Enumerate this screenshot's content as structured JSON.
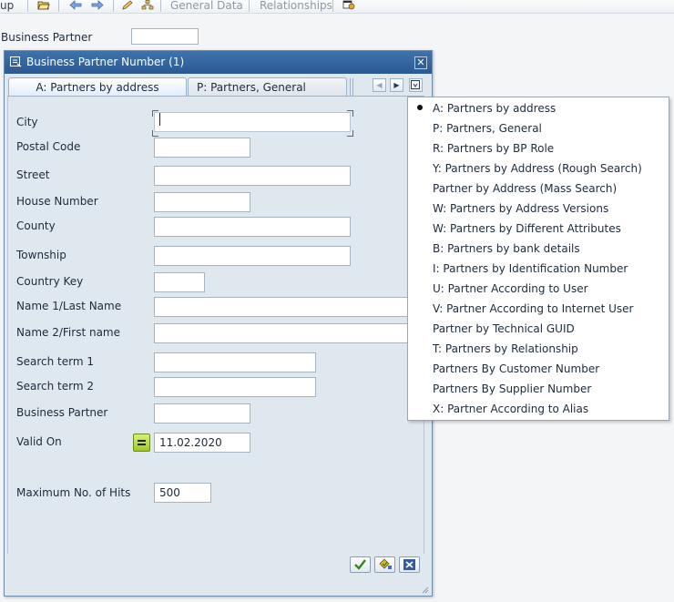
{
  "toolbar": {
    "group_tail_label": "up",
    "general_data_label": "General Data",
    "relationships_label": "Relationships"
  },
  "background": {
    "business_partner_label": "Business Partner"
  },
  "dialog": {
    "title": "Business Partner Number (1)",
    "close_glyph": "✕",
    "tabs": {
      "active": "A: Partners by address",
      "inactive": "P: Partners, General"
    },
    "fields": {
      "city": {
        "label": "City",
        "value": ""
      },
      "postal_code": {
        "label": "Postal Code",
        "value": ""
      },
      "street": {
        "label": "Street",
        "value": ""
      },
      "house_number": {
        "label": "House Number",
        "value": ""
      },
      "county": {
        "label": "County",
        "value": ""
      },
      "township": {
        "label": "Township",
        "value": ""
      },
      "country_key": {
        "label": "Country Key",
        "value": ""
      },
      "name1": {
        "label": "Name 1/Last Name",
        "value": ""
      },
      "name2": {
        "label": "Name 2/First name",
        "value": ""
      },
      "search_term1": {
        "label": "Search term 1",
        "value": ""
      },
      "search_term2": {
        "label": "Search term 2",
        "value": ""
      },
      "business_partner": {
        "label": "Business Partner",
        "value": ""
      },
      "valid_on": {
        "label": "Valid On",
        "value": "11.02.2020"
      },
      "max_hits": {
        "label": "Maximum No. of Hits",
        "value": "500"
      }
    }
  },
  "search_help_menu": {
    "selected_index": 0,
    "items": [
      "A: Partners by address",
      "P: Partners, General",
      "R: Partners by BP Role",
      "Y: Partners by Address (Rough Search)",
      "Partner by Address (Mass Search)",
      "W: Partners by Address Versions",
      "W: Partners by Different Attributes",
      "B: Partners by bank details",
      "I: Partners by Identification Number",
      "U: Partner According to User",
      "V: Partner According to Internet User",
      "Partner by Technical GUID",
      "T: Partners by Relationship",
      "Partners By Customer Number",
      "Partners By Supplier Number",
      "X: Partner According to Alias"
    ]
  },
  "colors": {
    "title_bar": "#2f5f98",
    "dialog_bg": "#dfe7ef",
    "focus_marker": "#d9362a",
    "accept_green": "#2f8a1e"
  },
  "icons": {
    "toolbar": [
      "open-folder-icon",
      "back-arrow-icon",
      "forward-arrow-icon",
      "edit-pencil-icon",
      "hierarchy-icon",
      "dialog-settings-icon"
    ],
    "dialog_title": "search-dialog-icon",
    "tab_nav": [
      "tab-prev-icon",
      "tab-next-icon",
      "tab-list-icon"
    ],
    "buttons": [
      "accept-check-icon",
      "multiple-selection-icon",
      "cancel-x-icon"
    ]
  }
}
